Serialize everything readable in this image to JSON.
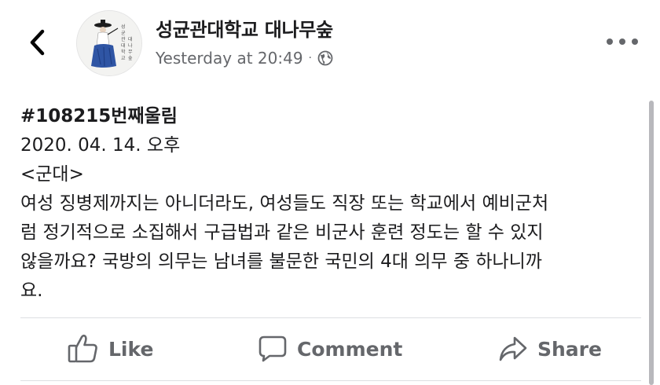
{
  "header": {
    "back_icon": "chevron-left-icon",
    "page_name": "성균관대학교 대나무숲",
    "timestamp": "Yesterday at 20:49",
    "separator": "·",
    "audience_icon": "globe-icon",
    "more_icon": "more-horizontal-icon",
    "avatar_text": [
      "성균관대학교",
      "대나무숲"
    ]
  },
  "post": {
    "lines": [
      "#108215번째울림",
      "2020. 04. 14. 오후",
      "<군대>",
      "여성 징병제까지는 아니더라도, 여성들도 직장 또는 학교에서 예비군처",
      "럼 정기적으로 소집해서 구급법과 같은 비군사 훈련 정도는 할 수 있지",
      "않을까요? 국방의 의무는 남녀를 불문한 국민의 4대 의무 중 하나니까",
      "요."
    ]
  },
  "actions": {
    "like": {
      "label": "Like",
      "icon": "thumbs-up-icon"
    },
    "comment": {
      "label": "Comment",
      "icon": "comment-bubble-icon"
    },
    "share": {
      "label": "Share",
      "icon": "share-arrow-icon"
    }
  },
  "colors": {
    "text_primary": "#1c1c1e",
    "text_secondary": "#65676b",
    "divider": "#dddfe2",
    "avatar_blue": "#2f55a4"
  }
}
